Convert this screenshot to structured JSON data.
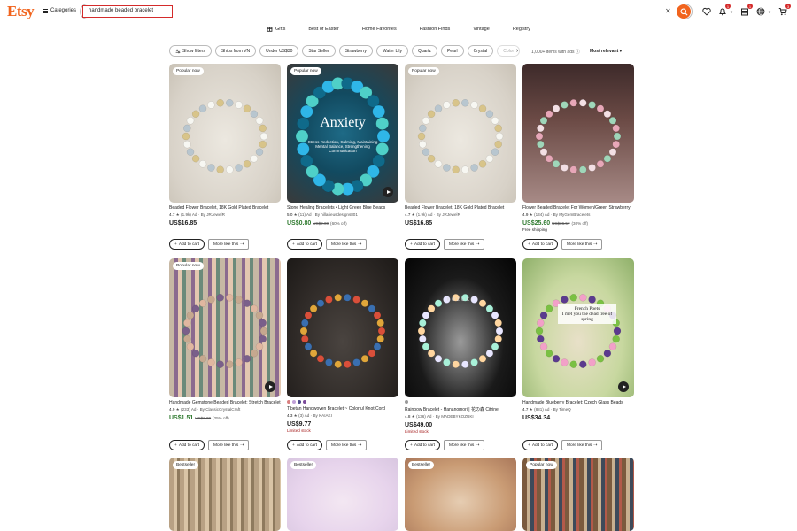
{
  "header": {
    "logo": "Etsy",
    "categories_label": "Categories",
    "search": {
      "value": "handmade beaded bracelet"
    },
    "icons": [
      "heart-icon",
      "bell-icon",
      "gift-icon",
      "globe-icon",
      "cart-icon"
    ],
    "badges": {
      "notifications": "1",
      "gifts": "1",
      "cart": "3"
    }
  },
  "nav": {
    "items": [
      "Gifts",
      "Best of Easter",
      "Home Favorites",
      "Fashion Finds",
      "Vintage",
      "Registry"
    ]
  },
  "filters": {
    "chips": [
      "Show filters",
      "Ships from VN",
      "Under US$30",
      "Star Seller",
      "Strawberry",
      "Water Lily",
      "Quartz",
      "Pearl",
      "Crystal",
      "Color"
    ],
    "results_text": "1,000+ items with ads ⓘ",
    "sort_label": "Most relevant ▾"
  },
  "colors": {
    "brand": "#f1641e",
    "sale": "#2f7a2f",
    "limited": "#a41b1b"
  },
  "products": [
    {
      "badge": "Popular now",
      "title": "Beaded Flower Bracelet, 18K Gold Plated Bracelet",
      "rating": "4.7",
      "reviews": "(1.9k)",
      "ad": "Ad",
      "seller": "By JRJewelR",
      "price": "US$16.85",
      "strike": "",
      "off": "",
      "extra": "",
      "video": false
    },
    {
      "badge": "Popular now",
      "title": "Stone Healing Bracelets • Light Green Blue Beads",
      "rating": "5.0",
      "reviews": "(11)",
      "ad": "Ad",
      "seller": "By hillarieusdesigns801",
      "price": "US$0.80",
      "strike": "US$2.00",
      "off": "(60% off)",
      "extra": "",
      "video": true,
      "image_text": "Anxiety",
      "image_subtext": "Stress Reduction, Calming, Maintaining Mental Balance, Strengthening Communication"
    },
    {
      "badge": "Popular now",
      "title": "Beaded Flower Bracelet, 18K Gold Plated Bracelet",
      "rating": "4.7",
      "reviews": "(1.9k)",
      "ad": "Ad",
      "seller": "By JRJewelR",
      "price": "US$16.85",
      "strike": "",
      "off": "",
      "extra": "",
      "video": false
    },
    {
      "badge": "",
      "title": "Flower Beaded Bracelet For Women/Green Strawberry",
      "rating": "4.9",
      "reviews": "(134)",
      "ad": "Ad",
      "seller": "By MyGemBracelets",
      "price": "US$25.60",
      "strike": "US$36.57",
      "off": "(30% off)",
      "extra": "Free shipping",
      "video": false
    },
    {
      "badge": "Popular now",
      "title": "Handmade Gemstone Beaded Bracelet: Stretch Bracelet",
      "rating": "4.9",
      "reviews": "(233)",
      "ad": "Ad",
      "seller": "By ClassicCrystalCraft",
      "price": "US$1.51",
      "strike": "US$2.00",
      "off": "(25% off)",
      "extra": "",
      "video": true
    },
    {
      "badge": "",
      "title": "Tibetan Handwoven Bracelet ~ Colorful Knot Cord",
      "rating": "4.3",
      "reviews": "(3)",
      "ad": "Ad",
      "seller": "By KAIAKI",
      "price": "US$9.77",
      "strike": "",
      "off": "",
      "extra": "Limited stock",
      "video": false
    },
    {
      "badge": "",
      "title": "Rainbow Bracelet - Hananomori | 花の森 Citrine",
      "rating": "4.8",
      "reviews": "(136)",
      "ad": "Ad",
      "seller": "By MADEBYKOZUKI",
      "price": "US$49.00",
      "strike": "",
      "off": "",
      "extra": "Limited stock",
      "video": false,
      "image_text": "KOZUKI"
    },
    {
      "badge": "",
      "title": "Handmade Blueberry Bracelet: Czech Glass Beads",
      "rating": "4.7",
      "reviews": "(881)",
      "ad": "Ad",
      "seller": "By TimeQ",
      "price": "US$34.34",
      "strike": "",
      "off": "",
      "extra": "",
      "video": true,
      "image_text": "French Poets\nI met you the dead tree of spring"
    },
    {
      "badge": "Bestseller",
      "title": "",
      "rating": "",
      "reviews": "",
      "ad": "",
      "seller": "",
      "price": "",
      "strike": "",
      "off": "",
      "extra": "",
      "video": false
    },
    {
      "badge": "Bestseller",
      "title": "",
      "rating": "",
      "reviews": "",
      "ad": "",
      "seller": "",
      "price": "",
      "strike": "",
      "off": "",
      "extra": "",
      "video": false
    },
    {
      "badge": "Bestseller",
      "title": "",
      "rating": "",
      "reviews": "",
      "ad": "",
      "seller": "",
      "price": "",
      "strike": "",
      "off": "",
      "extra": "",
      "video": false
    },
    {
      "badge": "Popular now",
      "title": "",
      "rating": "",
      "reviews": "",
      "ad": "",
      "seller": "",
      "price": "",
      "strike": "",
      "off": "",
      "extra": "",
      "video": false
    }
  ],
  "buttons": {
    "add_to_cart": "Add to cart",
    "more_like_this": "More like this"
  }
}
